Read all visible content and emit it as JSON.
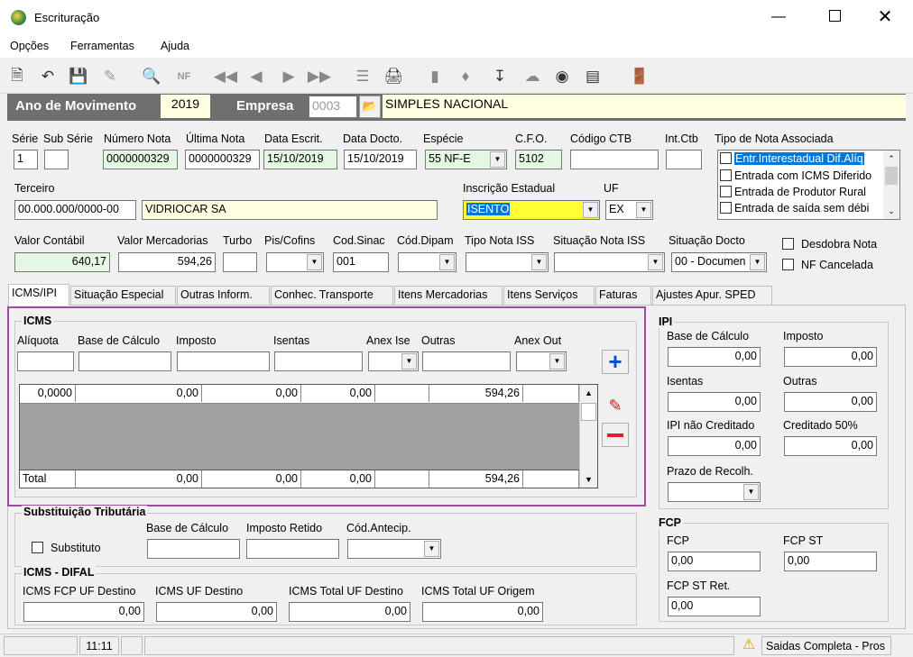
{
  "window": {
    "title": "Escrituração"
  },
  "menu": [
    "Opções",
    "Ferramentas",
    "Ajuda"
  ],
  "header": {
    "ano_label": "Ano de Movimento",
    "ano_value": "2019",
    "empresa_label": "Empresa",
    "empresa_code": "0003",
    "empresa_name": "SIMPLES NACIONAL"
  },
  "fields": {
    "serie": {
      "label": "Série",
      "value": "1"
    },
    "sub_serie": {
      "label": "Sub Série",
      "value": ""
    },
    "numero_nota": {
      "label": "Número Nota",
      "value": "0000000329"
    },
    "ultima_nota": {
      "label": "Última Nota",
      "value": "0000000329"
    },
    "data_escrit": {
      "label": "Data Escrit.",
      "value": "15/10/2019"
    },
    "data_docto": {
      "label": "Data Docto.",
      "value": "15/10/2019"
    },
    "especie": {
      "label": "Espécie",
      "value": "55   NF-E"
    },
    "cfo": {
      "label": "C.F.O.",
      "value": "5102"
    },
    "codigo_ctb": {
      "label": "Código CTB",
      "value": ""
    },
    "int_ctb": {
      "label": "Int.Ctb",
      "value": ""
    },
    "terceiro": {
      "label": "Terceiro",
      "cnpj": "00.000.000/0000-00",
      "nome": "VIDRIOCAR SA"
    },
    "inscricao": {
      "label": "Inscrição Estadual",
      "value": "ISENTO"
    },
    "uf": {
      "label": "UF",
      "value": "EX"
    },
    "valor_contabil": {
      "label": "Valor Contábil",
      "value": "640,17"
    },
    "valor_mercadorias": {
      "label": "Valor Mercadorias",
      "value": "594,26"
    },
    "turbo": {
      "label": "Turbo",
      "value": ""
    },
    "pis_cofins": {
      "label": "Pis/Cofins",
      "value": ""
    },
    "cod_sinac": {
      "label": "Cod.Sinac",
      "value": "001"
    },
    "cod_dipam": {
      "label": "Cód.Dipam",
      "value": ""
    },
    "tipo_nota_iss": {
      "label": "Tipo Nota ISS",
      "value": ""
    },
    "situacao_nota_iss": {
      "label": "Situação Nota ISS",
      "value": ""
    },
    "situacao_docto": {
      "label": "Situação Docto",
      "value": "00 - Documen"
    }
  },
  "tipo_nota_associada": {
    "label": "Tipo de Nota Associada",
    "items": [
      "Entr.Interestadual Dif.Alíq",
      "Entrada com ICMS Diferido",
      "Entrada de Produtor Rural",
      "Entrada de saída sem débi"
    ]
  },
  "checks": {
    "desdobra": "Desdobra Nota",
    "nf_cancelada": "NF Cancelada",
    "substituto": "Substituto"
  },
  "tabs": [
    "ICMS/IPI",
    "Situação Especial",
    "Outras Inform.",
    "Conhec. Transporte",
    "Itens Mercadorias",
    "Itens Serviços",
    "Faturas",
    "Ajustes Apur. SPED"
  ],
  "icms": {
    "title": "ICMS",
    "cols": [
      "Alíquota",
      "Base de Cálculo",
      "Imposto",
      "Isentas",
      "Anex Ise",
      "Outras",
      "Anex Out"
    ],
    "row": [
      "0,0000",
      "0,00",
      "0,00",
      "0,00",
      "",
      "594,26",
      ""
    ],
    "total_label": "Total",
    "total": [
      "0,00",
      "0,00",
      "0,00",
      "",
      "594,26"
    ]
  },
  "st": {
    "title": "Substituição Tributária",
    "base": "Base de Cálculo",
    "retido": "Imposto Retido",
    "cod": "Cód.Antecip."
  },
  "difal": {
    "title": "ICMS - DIFAL",
    "labels": [
      "ICMS FCP UF Destino",
      "ICMS UF Destino",
      "ICMS Total UF Destino",
      "ICMS Total UF Origem"
    ],
    "values": [
      "0,00",
      "0,00",
      "0,00",
      "0,00"
    ]
  },
  "ipi": {
    "title": "IPI",
    "base": "Base de Cálculo",
    "base_v": "0,00",
    "imposto": "Imposto",
    "imposto_v": "0,00",
    "isentas": "Isentas",
    "isentas_v": "0,00",
    "outras": "Outras",
    "outras_v": "0,00",
    "nao_cred": "IPI não Creditado",
    "nao_cred_v": "0,00",
    "cred50": "Creditado 50%",
    "cred50_v": "0,00",
    "prazo": "Prazo de Recolh."
  },
  "fcp": {
    "title": "FCP",
    "fcp": "FCP",
    "fcp_v": "0,00",
    "fcp_st": "FCP ST",
    "fcp_st_v": "0,00",
    "fcp_st_ret": "FCP ST Ret.",
    "fcp_st_ret_v": "0,00"
  },
  "status": {
    "time": "11:11",
    "message": "Saidas Completa - Pros"
  }
}
